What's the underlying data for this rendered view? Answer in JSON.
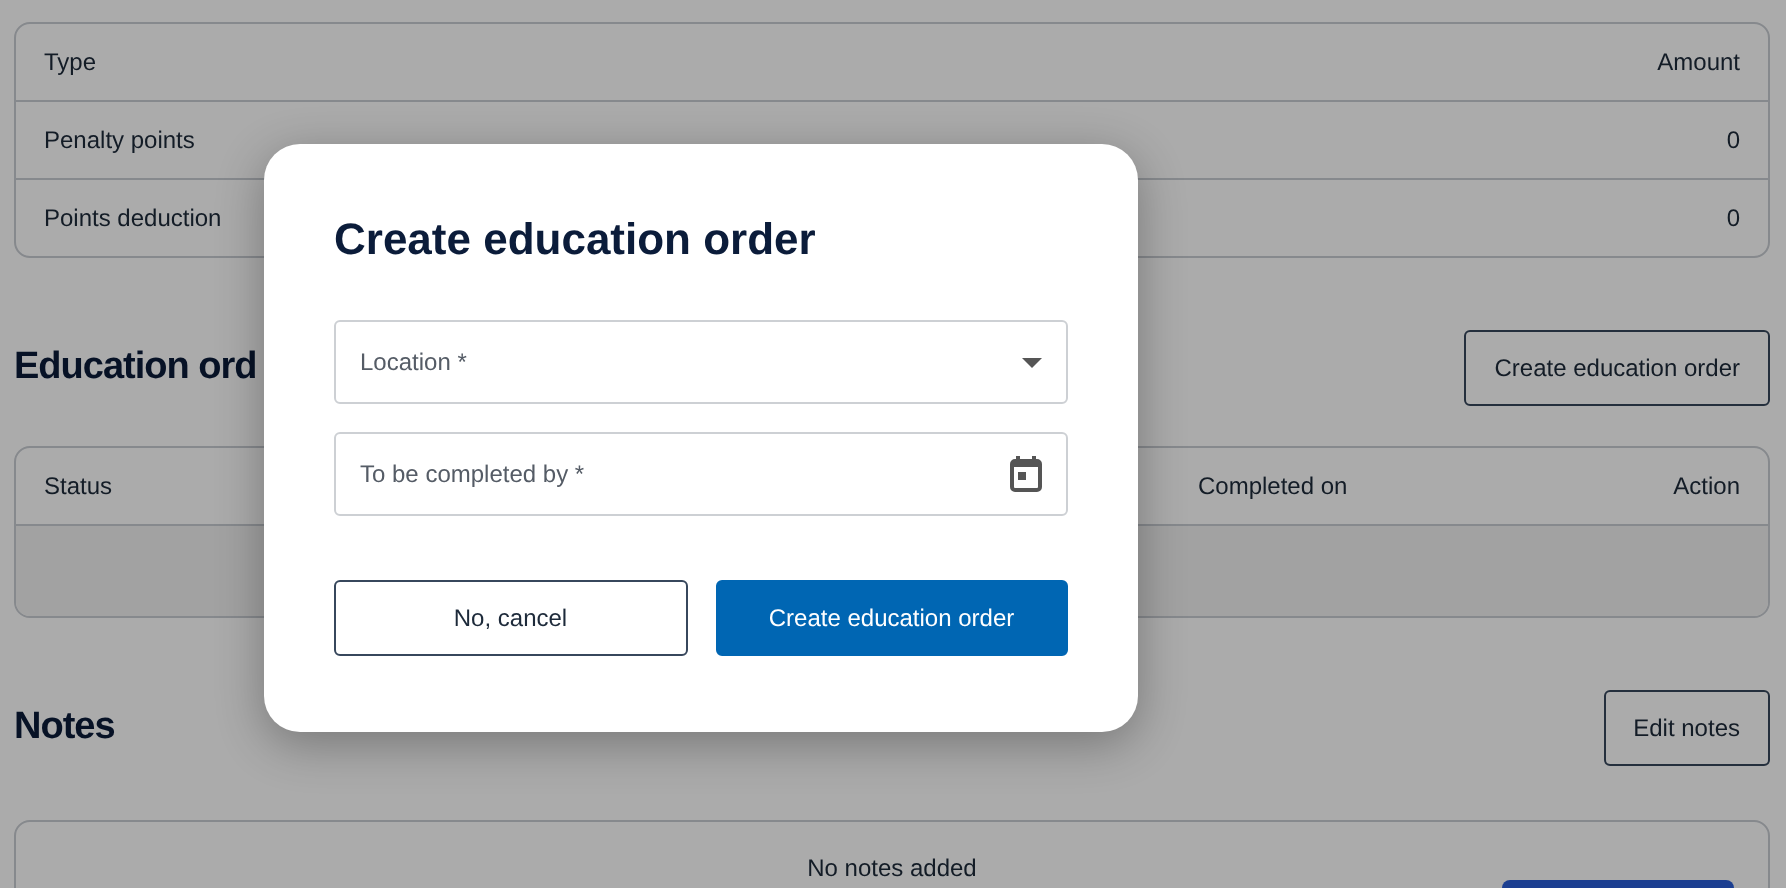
{
  "penalty_table": {
    "columns": [
      "Type",
      "Amount"
    ],
    "rows": [
      {
        "type": "Penalty points",
        "amount": "0"
      },
      {
        "type": "Points deduction",
        "amount": "0"
      }
    ]
  },
  "education_orders": {
    "heading": "Education ord",
    "create_button": "Create education order",
    "columns": [
      "Status",
      "Completed on",
      "Action"
    ]
  },
  "notes": {
    "heading": "Notes",
    "edit_button": "Edit notes",
    "empty_text": "No notes added"
  },
  "dialog": {
    "title": "Create education order",
    "fields": [
      {
        "kind": "select",
        "placeholder": "Location *"
      },
      {
        "kind": "date",
        "placeholder": "To be completed by *"
      }
    ],
    "buttons": [
      {
        "kind": "secondary",
        "label": "No, cancel"
      },
      {
        "kind": "primary",
        "label": "Create education order"
      }
    ]
  }
}
